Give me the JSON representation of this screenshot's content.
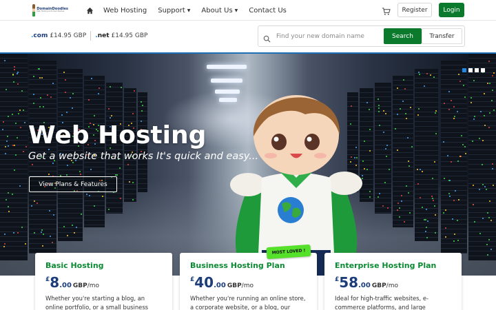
{
  "header": {
    "logo_text": "DomainDoodles",
    "logo_tagline": "Web Hosting & Domain Names",
    "nav": {
      "home_icon": "home-icon",
      "items": [
        {
          "label": "Web Hosting",
          "dropdown": false
        },
        {
          "label": "Support",
          "dropdown": true
        },
        {
          "label": "About Us",
          "dropdown": true
        },
        {
          "label": "Contact Us",
          "dropdown": false
        }
      ]
    },
    "cart_icon": "cart-icon",
    "register_label": "Register",
    "login_label": "Login"
  },
  "domain_bar": {
    "tlds": [
      {
        "ext": "com",
        "price": "£14.95 GBP"
      },
      {
        "ext": "net",
        "price": "£14.95 GBP"
      }
    ],
    "search_placeholder": "Find your new domain name",
    "search_label": "Search",
    "transfer_label": "Transfer"
  },
  "hero": {
    "title": "Web Hosting",
    "subtitle": "Get a website that works It's quick and easy...",
    "cta_label": "View Plans & Features",
    "slide_count": 4,
    "active_slide": 1
  },
  "plans": [
    {
      "name": "Basic Hosting",
      "currency": "£",
      "amount": "8",
      "decimal": ".00",
      "code": "GBP",
      "period": "/mo",
      "description": "Whether you're starting a blog, an online portfolio, or a small business website, our"
    },
    {
      "name": "Business Hosting Plan",
      "currency": "£",
      "amount": "40",
      "decimal": ".00",
      "code": "GBP",
      "period": "/mo",
      "description": "Whether you're running an online store, a corporate website, or a blog, our Business",
      "badge": "MOST LOVED !"
    },
    {
      "name": "Enterprise Hosting Plan",
      "currency": "£",
      "amount": "58",
      "decimal": ".00",
      "code": "GBP",
      "period": "/mo",
      "description": "Ideal for high-traffic websites, e-commerce platforms, and large"
    }
  ],
  "colors": {
    "accent_green": "#0b7a2d",
    "plan_title_green": "#0b8a32",
    "price_navy": "#1c3d7a",
    "slider_active": "#1e88e5"
  }
}
